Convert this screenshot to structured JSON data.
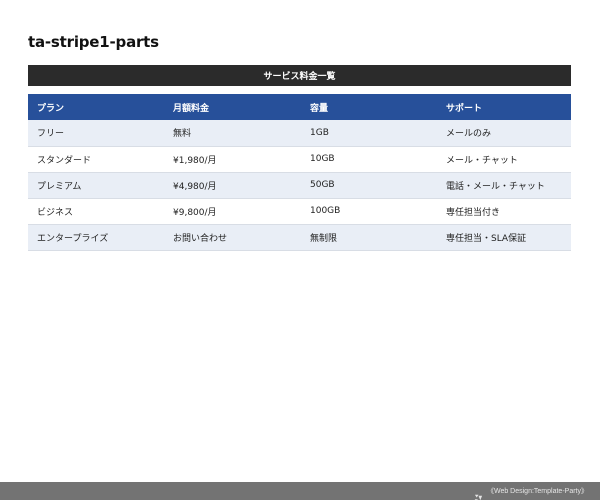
{
  "page": {
    "title": "ta-stripe1-parts"
  },
  "table": {
    "caption": "サービス料金一覧",
    "headers": [
      "プラン",
      "月額料金",
      "容量",
      "サポート"
    ],
    "rows": [
      [
        "フリー",
        "無料",
        "1GB",
        "メールのみ"
      ],
      [
        "スタンダード",
        "¥1,980/月",
        "10GB",
        "メール・チャット"
      ],
      [
        "プレミアム",
        "¥4,980/月",
        "50GB",
        "電話・メール・チャット"
      ],
      [
        "ビジネス",
        "¥9,800/月",
        "100GB",
        "専任担当付き"
      ],
      [
        "エンタープライズ",
        "お問い合わせ",
        "無制限",
        "専任担当・SLA保証"
      ]
    ]
  },
  "footer": {
    "text": "《Web Design:Template-Party》",
    "icon": "template-party-logo-icon"
  },
  "colors": {
    "caption_bg": "#2b2b2b",
    "header_bg": "#27509a",
    "stripe_bg": "#e9eef6",
    "footer_bg": "#737373"
  }
}
